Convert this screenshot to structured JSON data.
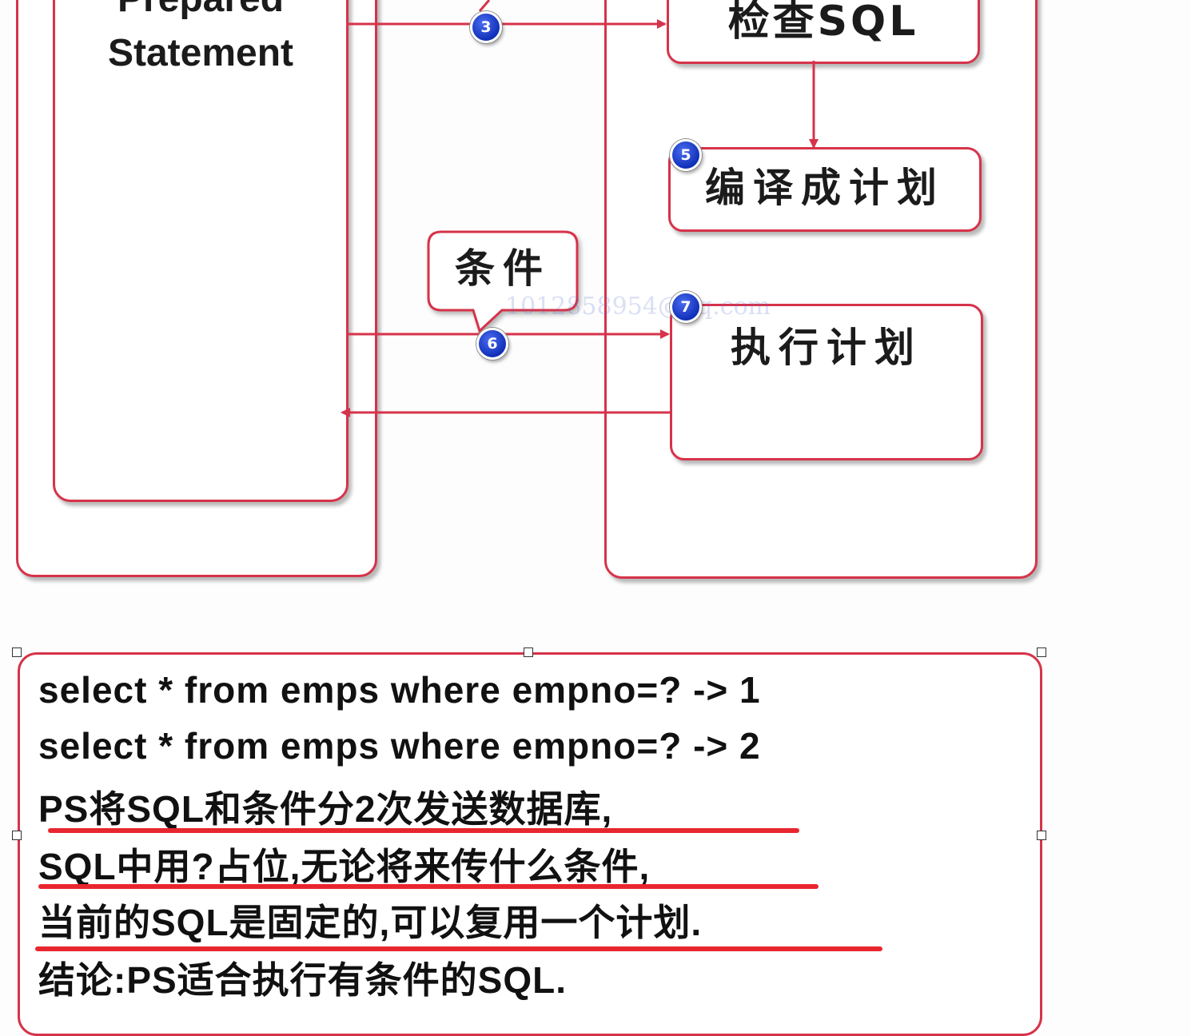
{
  "diagram": {
    "client_box_label": "Prepared\nStatement",
    "check_sql_label": "检查SQL",
    "compile_plan_label": "编译成计划",
    "condition_callout_label": "条件",
    "execute_plan_label": "执行计划",
    "badges": {
      "b3": "3",
      "b5": "5",
      "b6": "6",
      "b7": "7"
    },
    "watermark": "1012858954@qq.com",
    "accent_color": "#d6334a",
    "badge_color": "#1e40d0"
  },
  "note": {
    "lines": [
      "select * from emps where empno=?  -> 1",
      "select * from emps where empno=?  -> 2",
      "PS将SQL和条件分2次发送数据库,",
      "SQL中用?占位,无论将来传什么条件,",
      "当前的SQL是固定的,可以复用一个计划.",
      "结论:PS适合执行有条件的SQL."
    ],
    "underline_color": "#e8262f"
  }
}
